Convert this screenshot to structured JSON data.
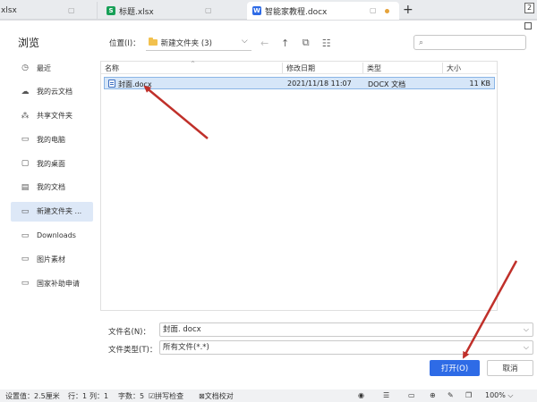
{
  "tabs": [
    {
      "label": "xlsx"
    },
    {
      "label": "标题.xlsx",
      "icon": "spreadsheet-icon",
      "color": "#18a058"
    },
    {
      "label": "智能家教程.docx",
      "icon": "writer-doc-icon",
      "color": "#2e6be6"
    }
  ],
  "window": {
    "counter": "2"
  },
  "dialog": {
    "title": "浏览",
    "location_label": "位置(I)：",
    "location_value": "新建文件夹 (3)",
    "search_placeholder": ""
  },
  "sidebar": {
    "items": [
      {
        "label": "最近",
        "icon": "clock-icon"
      },
      {
        "label": "我的云文档",
        "icon": "cloud-icon"
      },
      {
        "label": "共享文件夹",
        "icon": "share-icon"
      },
      {
        "label": "我的电脑",
        "icon": "monitor-icon"
      },
      {
        "label": "我的桌面",
        "icon": "desktop-icon"
      },
      {
        "label": "我的文档",
        "icon": "document-folder-icon"
      },
      {
        "label": "新建文件夹 ...",
        "icon": "folder-icon",
        "active": true
      },
      {
        "label": "Downloads",
        "icon": "folder-icon"
      },
      {
        "label": "图片素材",
        "icon": "folder-icon"
      },
      {
        "label": "国家补助申请",
        "icon": "folder-icon"
      }
    ]
  },
  "file_list": {
    "columns": [
      "名称",
      "修改日期",
      "类型",
      "大小"
    ],
    "rows": [
      {
        "name": "封面.docx",
        "modified": "2021/11/18 11:07",
        "type": "DOCX 文档",
        "size": "11 KB"
      }
    ]
  },
  "form": {
    "filename_label": "文件名(N)：",
    "filename_value": "封面. docx",
    "filetype_label": "文件类型(T)：",
    "filetype_value": "所有文件(*.*)",
    "open_label": "打开(O)",
    "cancel_label": "取消"
  },
  "statusbar": {
    "position": "设置值：2.5厘米",
    "row": "行：1",
    "col": "列：1",
    "words": "字数：5",
    "spellcheck": "拼写检查",
    "proofread": "文档校对",
    "zoom": "100%"
  },
  "colors": {
    "accent": "#2e6be6",
    "annotation": "#c0302a",
    "selection": "#d6e6f8"
  }
}
